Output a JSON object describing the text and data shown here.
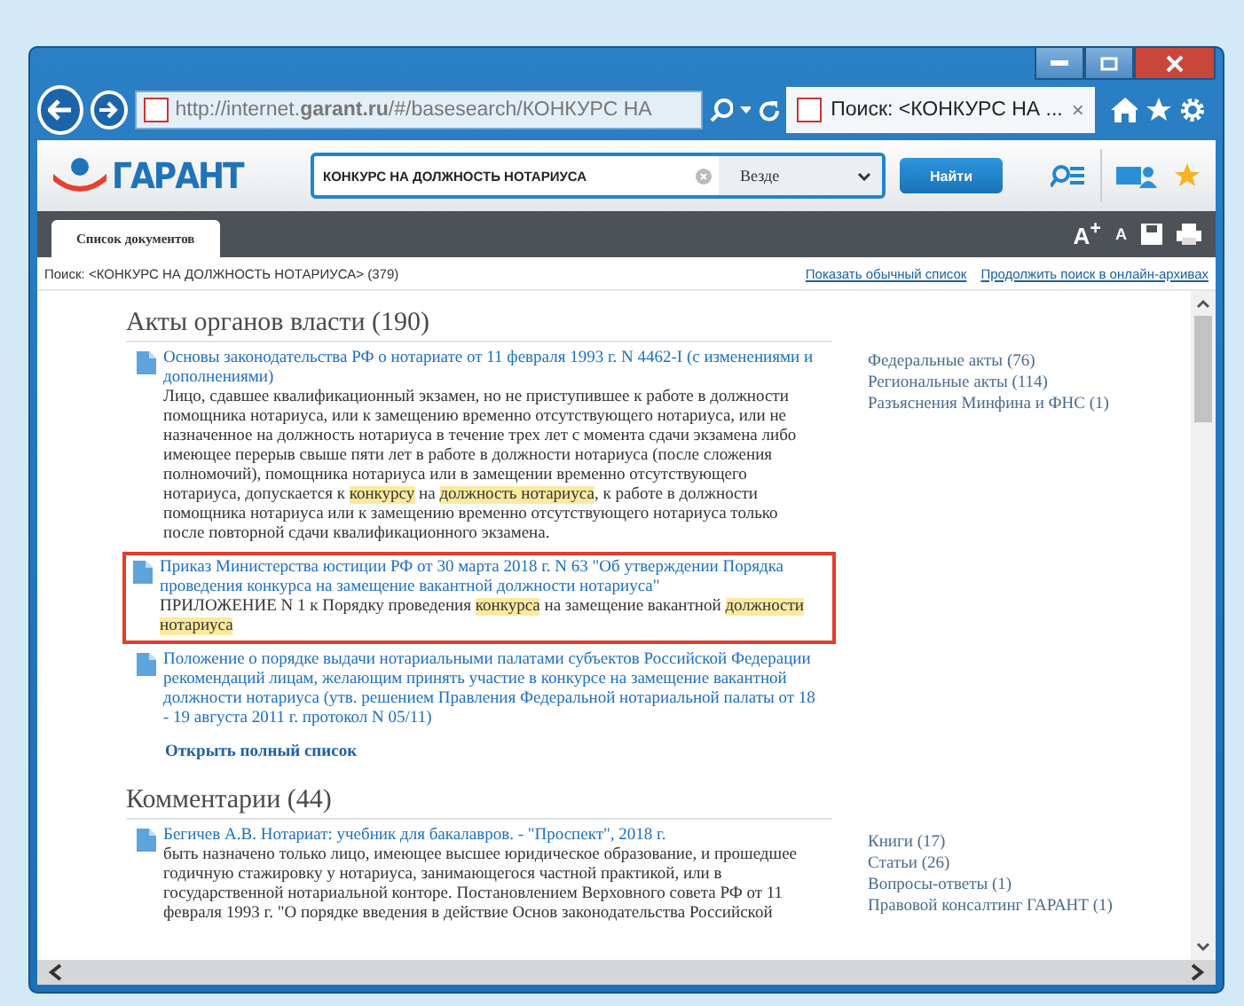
{
  "browser": {
    "address": "http://internet.**garant.ru**/#/basesearch/КОНКУРС НА",
    "tab": {
      "title": "Поиск: <КОНКУРС НА ...",
      "close": "×",
      "selected": true
    }
  },
  "header": {
    "logo_text": "ГАРАНТ",
    "search_value": "КОНКУРС НА ДОЛЖНОСТЬ НОТАРИУСА",
    "scope": "Везде",
    "search_button": "Найти"
  },
  "tabs": [
    {
      "label": "Список документов",
      "selected": true
    }
  ],
  "font_buttons": [
    "A$^{+}$",
    "A"
  ],
  "search_info": {
    "query": "Поиск: <КОНКУРС НА ДОЛЖНОСТЬ НОТАРИУСА> (379)",
    "links": [
      "Показать обычный список",
      "Продолжить поиск в онлайн-архивах"
    ]
  },
  "sections": [
    {
      "title": "Акты органов власти (190)",
      "documents": [
        {
          "title": "Основы законодательства РФ о нотариате от 11 февраля 1993 г. N 4462-I (с изменениями и дополнениями)",
          "outlined": false,
          "snippet": [
            {
              "text": "Лицо, сдавшее квалификационный экзамен, но не приступившее к работе в должности помощника нотариуса, или к замещению временно отсутствующего нотариуса, или не назначенное на должность нотариуса в течение трех лет с момента сдачи экзамена либо имеющее перерыв свыше пяти лет в работе в должности нотариуса (после сложения полномочий), помощника нотариуса или в замещении временно отсутствующего нотариуса, допускается к ",
              "highlight": false
            },
            {
              "text": "конкурсу",
              "highlight": true
            },
            {
              "text": " на ",
              "highlight": false
            },
            {
              "text": "должность нотариуса",
              "highlight": true
            },
            {
              "text": ", к работе в должности помощника нотариуса или к замещению временно отсутствующего нотариуса только после повторной сдачи квалификационного экзамена.",
              "highlight": false
            }
          ]
        },
        {
          "title": "Приказ Министерства юстиции РФ от 30 марта 2018 г. N 63 \"Об утверждении Порядка проведения конкурса на замещение вакантной должности нотариуса\"",
          "outlined": true,
          "snippet": [
            {
              "text": "ПРИЛОЖЕНИЕ N 1 к Порядку проведения ",
              "highlight": false
            },
            {
              "text": "конкурса",
              "highlight": true
            },
            {
              "text": " на замещение вакантной ",
              "highlight": false
            },
            {
              "text": "должности нотариуса",
              "highlight": true
            }
          ]
        },
        {
          "title": "Положение о порядке выдачи нотариальными палатами субъектов Российской Федерации рекомендаций лицам, желающим принять участие в конкурсе на замещение вакантной должности нотариуса (утв. решением Правления Федеральной нотариальной палаты от 18 - 19 августа 2011 г. протокол N 05/11)",
          "outlined": false
        }
      ],
      "more_link": "Открыть полный список",
      "side_links": [
        "Федеральные акты (76)",
        "Региональные акты (114)",
        "Разъяснения Минфина и ФНС (1)"
      ]
    },
    {
      "title": "Комментарии (44)",
      "documents": [
        {
          "title": "Бегичев А.В. Нотариат: учебник для бакалавров. - \"Проспект\", 2018 г.",
          "outlined": false,
          "snippet": [
            {
              "text": "быть назначено только лицо, имеющее высшее юридическое образование, и прошедшее годичную стажировку у нотариуса, занимающегося частной практикой, или в государственной нотариальной конторе. Постановлением Верховного совета РФ от 11 февраля 1993 г. \"О порядке введения в действие Основ законодательства Российской",
              "highlight": false
            }
          ]
        }
      ],
      "side_links": [
        "Книги (17)",
        "Статьи (26)",
        "Вопросы-ответы (1)",
        "Правовой консалтинг ГАРАНТ (1)"
      ]
    }
  ]
}
